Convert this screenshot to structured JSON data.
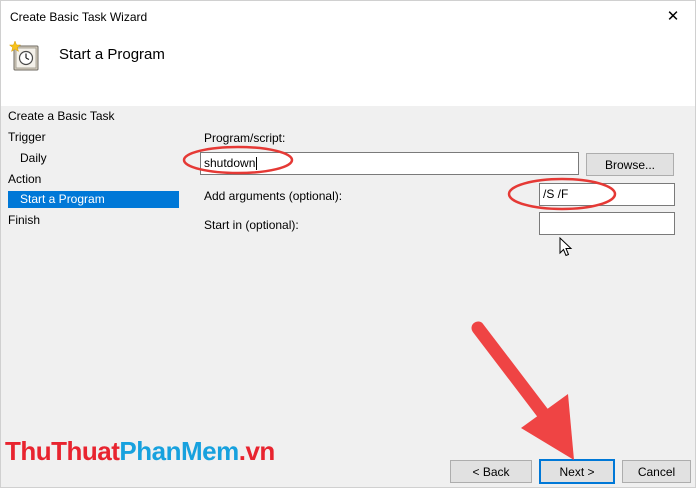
{
  "window": {
    "title": "Create Basic Task Wizard",
    "close_glyph": "✕",
    "header_title": "Start a Program",
    "header_icon": "task-scheduler-clock-icon"
  },
  "steps": [
    {
      "label": "Create a Basic Task",
      "indent": false,
      "selected": false
    },
    {
      "label": "Trigger",
      "indent": false,
      "selected": false
    },
    {
      "label": "Daily",
      "indent": true,
      "selected": false
    },
    {
      "label": "Action",
      "indent": false,
      "selected": false
    },
    {
      "label": "Start a Program",
      "indent": true,
      "selected": true
    },
    {
      "label": "Finish",
      "indent": false,
      "selected": false
    }
  ],
  "form": {
    "program_label": "Program/script:",
    "program_value": "shutdown",
    "browse_label": "Browse...",
    "args_label": "Add arguments (optional):",
    "args_value": "/S /F",
    "startin_label": "Start in (optional):",
    "startin_value": ""
  },
  "buttons": {
    "back": "< Back",
    "next": "Next >",
    "cancel": "Cancel"
  },
  "watermark": {
    "part1": "ThuThuat",
    "part2": "PhanMem",
    "part3": ".vn"
  },
  "colors": {
    "selection": "#0078d7",
    "annotation": "#e53935",
    "watermark_red": "#e8242f",
    "watermark_blue": "#17a1de"
  }
}
